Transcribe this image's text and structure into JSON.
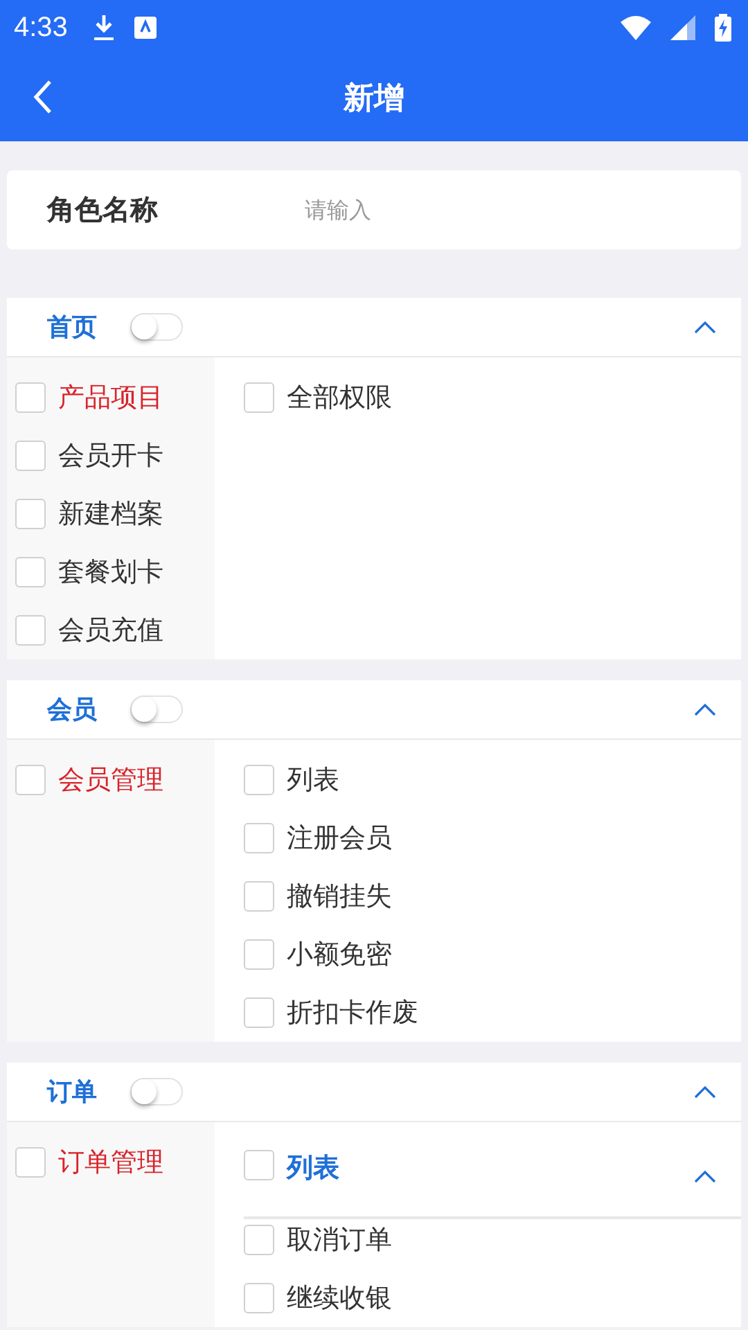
{
  "status_bar": {
    "time": "4:33"
  },
  "header": {
    "title": "新增"
  },
  "role_name": {
    "label": "角色名称",
    "placeholder": "请输入"
  },
  "sections": [
    {
      "title": "首页",
      "on": false,
      "expanded": true,
      "categories": [
        {
          "label": "产品项目",
          "selected": true,
          "checked": false
        },
        {
          "label": "会员开卡",
          "selected": false,
          "checked": false
        },
        {
          "label": "新建档案",
          "selected": false,
          "checked": false
        },
        {
          "label": "套餐划卡",
          "selected": false,
          "checked": false
        },
        {
          "label": "会员充值",
          "selected": false,
          "checked": false
        }
      ],
      "permissions": [
        {
          "kind": "item",
          "label": "全部权限",
          "checked": false
        }
      ]
    },
    {
      "title": "会员",
      "on": false,
      "expanded": true,
      "categories": [
        {
          "label": "会员管理",
          "selected": true,
          "checked": false
        }
      ],
      "permissions": [
        {
          "kind": "item",
          "label": "列表",
          "checked": false
        },
        {
          "kind": "item",
          "label": "注册会员",
          "checked": false
        },
        {
          "kind": "item",
          "label": "撤销挂失",
          "checked": false
        },
        {
          "kind": "item",
          "label": "小额免密",
          "checked": false
        },
        {
          "kind": "item",
          "label": "折扣卡作废",
          "checked": false
        }
      ]
    },
    {
      "title": "订单",
      "on": false,
      "expanded": true,
      "categories": [
        {
          "label": "订单管理",
          "selected": true,
          "checked": false
        }
      ],
      "permissions": [
        {
          "kind": "group",
          "label": "列表",
          "checked": false,
          "expanded": true
        },
        {
          "kind": "item",
          "label": "取消订单",
          "checked": false
        },
        {
          "kind": "item",
          "label": "继续收银",
          "checked": false
        }
      ]
    }
  ]
}
